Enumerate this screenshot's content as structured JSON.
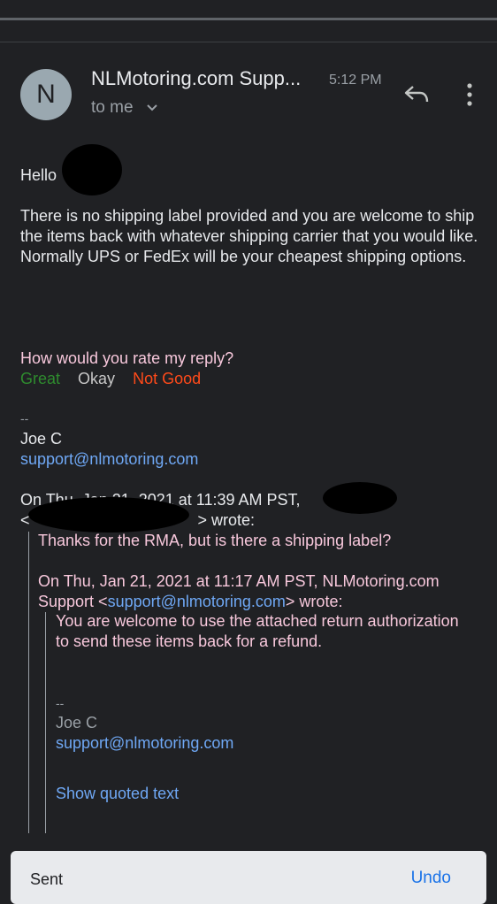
{
  "header": {
    "avatar_letter": "N",
    "sender": "NLMotoring.com Supp...",
    "time": "5:12 PM",
    "to_me": "to me"
  },
  "message": {
    "greeting": "Hello",
    "paragraph": "There is no shipping label provided and you are welcome to ship the items back with whatever shipping carrier that you would like. Normally UPS or FedEx will be your cheapest shipping options.",
    "rating_question": "How would you rate my reply?",
    "rating_great": "Great",
    "rating_okay": "Okay",
    "rating_not_good": "Not Good",
    "sig_dashes": "--",
    "sig_name": "Joe C",
    "sig_email": "support@nlmotoring.com"
  },
  "quote1": {
    "line1_prefix": "On Thu, Jan 21, 2021 at 11:39 AM PST,",
    "line2_prefix": "<",
    "line2_suffix": "> wrote:",
    "text": "Thanks for the RMA, but is there a shipping label?"
  },
  "quote2": {
    "header_line1": "On Thu, Jan 21, 2021 at 11:17 AM PST, NLMotoring.com",
    "header_prefix": "Support <",
    "header_email": "support@nlmotoring.com",
    "header_suffix": "> wrote:",
    "text": "You are welcome to use the attached return authorization to send these items back for a refund.",
    "sig_dashes": "--",
    "sig_name": "Joe C",
    "sig_email": "support@nlmotoring.com",
    "show_quoted": "Show quoted text"
  },
  "snackbar": {
    "label": "Sent",
    "undo": "Undo"
  },
  "colors": {
    "background": "#202124",
    "link": "#6fa8f5",
    "great": "#2e8b2e",
    "not_good": "#ff4a1a",
    "quote_text": "#f8c8dc"
  },
  "icons": [
    "reply-icon",
    "more-vert-icon",
    "chevron-down-icon"
  ]
}
